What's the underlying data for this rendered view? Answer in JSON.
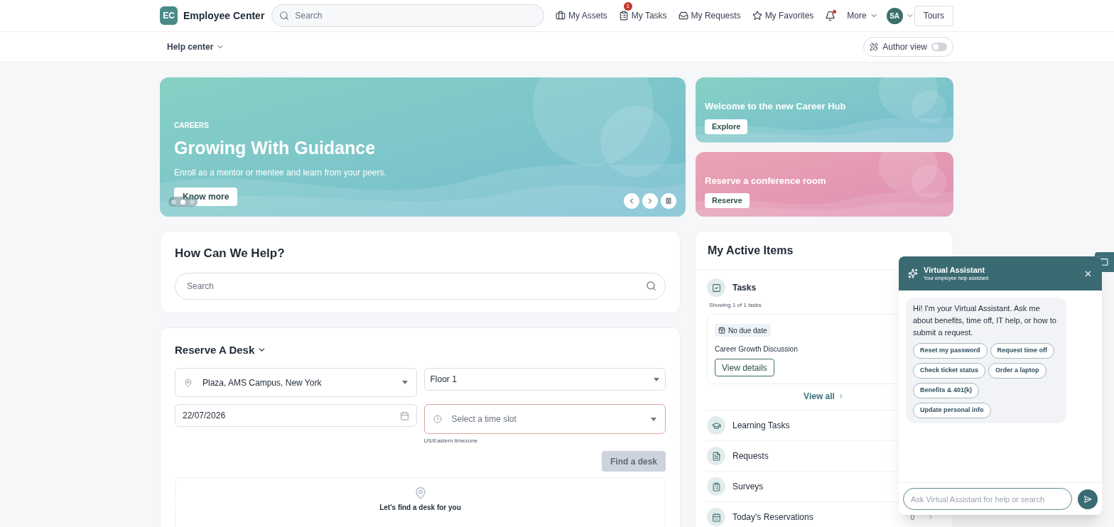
{
  "header": {
    "logo": "EC",
    "title": "Employee Center",
    "search": {
      "placeholder": "Search"
    },
    "nav": [
      {
        "label": "My Assets"
      },
      {
        "label": "My Tasks",
        "badge": "1"
      },
      {
        "label": "My Requests"
      },
      {
        "label": "My Favorites"
      }
    ],
    "notifications": {
      "unread": true
    },
    "more": "More",
    "avatar": "SA",
    "tours": "Tours"
  },
  "subheader": {
    "menu": "Help center",
    "author_view": {
      "label": "Author view",
      "on": false
    }
  },
  "hero": {
    "eyebrow": "CAREERS",
    "title": "Growing With Guidance",
    "text": "Enroll as a mentor or mentee and learn from your peers.",
    "button": "Know more",
    "dots": [
      {
        "selected": false
      },
      {
        "selected": true
      },
      {
        "selected": false
      }
    ]
  },
  "promos": [
    {
      "title": "Welcome to the new Career Hub",
      "button": "Explore",
      "kind": "teal"
    },
    {
      "title": "Reserve a conference room",
      "button": "Reserve",
      "kind": "pink"
    }
  ],
  "help": {
    "title": "How Can We Help?",
    "search": {
      "placeholder": "Search"
    }
  },
  "reserve": {
    "title": "Reserve A Desk",
    "location": "Plaza, AMS Campus, New York",
    "floor": "Floor 1",
    "date": "22/07/2026",
    "time_slot": {
      "placeholder": "Select a time slot",
      "error": true
    },
    "timezone": "US/Eastern timezone",
    "find_button": {
      "label": "Find a desk",
      "disabled": true
    },
    "empty_text": "Let's find a desk for you"
  },
  "active_items": {
    "title": "My Active Items",
    "tasks": {
      "label": "Tasks",
      "summary": "Showing 1 of 1 tasks",
      "items": [
        {
          "tag": "No due date",
          "title": "Career Growth Discussion",
          "button": "View details"
        }
      ],
      "view_all": "View all"
    },
    "sections": [
      {
        "label": "Learning Tasks"
      },
      {
        "label": "Requests"
      },
      {
        "label": "Surveys"
      },
      {
        "label": "Today's Reservations",
        "count": "0"
      }
    ]
  },
  "assistant": {
    "title": "Virtual Assistant",
    "subtitle": "Your employee help assistant",
    "message": "Hi! I'm your Virtual Assistant. Ask me about benefits, time off, IT help, or how to submit a request.",
    "suggestions": [
      "Reset my password",
      "Request time off",
      "Check ticket status",
      "Order a laptop",
      "Benefits & 401(k)",
      "Update personal info"
    ],
    "input": {
      "placeholder": "Ask Virtual Assistant for help or search"
    }
  }
}
